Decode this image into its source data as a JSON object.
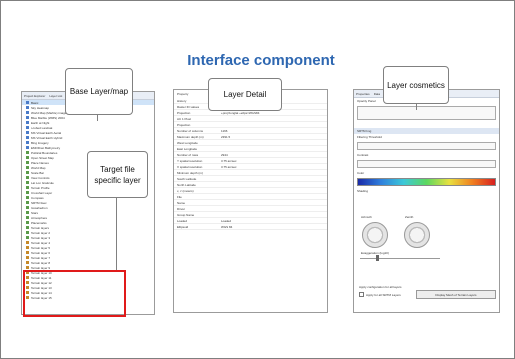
{
  "page": {
    "title": "Interface component"
  },
  "callouts": {
    "base_layer": "Base Layer/map",
    "target_file": "Target file specific layer",
    "layer_detail": "Layer Detail",
    "layer_cosmetics": "Layer cosmetics"
  },
  "colors": {
    "title": "#2e67b1",
    "highlight_box": "#e01a1a"
  },
  "left_panel": {
    "tabs": [
      "Project Explorer",
      "Layer List"
    ],
    "rows": [
      {
        "label": "Basic",
        "icon": "map-icon",
        "selected": true
      },
      {
        "label": "Sky Heatmap",
        "icon": "map-icon"
      },
      {
        "label": "World Map (Marble) image",
        "icon": "map-icon"
      },
      {
        "label": "Blue Marble (WMS) 2004",
        "icon": "map-icon"
      },
      {
        "label": "Earth at Night",
        "icon": "map-icon"
      },
      {
        "label": "i-cubed Landsat",
        "icon": "map-icon"
      },
      {
        "label": "MS Virtual Earth Aerial",
        "icon": "map-icon"
      },
      {
        "label": "MS Virtual Earth Hybrid",
        "icon": "map-icon"
      },
      {
        "label": "Bing Imagery",
        "icon": "map-icon"
      },
      {
        "label": "EMODnet Bathymetry",
        "icon": "map-icon"
      },
      {
        "label": "Political Boundaries",
        "icon": "layer-icon"
      },
      {
        "label": "Open Street Map",
        "icon": "layer-icon"
      },
      {
        "label": "Place Names",
        "icon": "layer-icon"
      },
      {
        "label": "World Map",
        "icon": "layer-icon"
      },
      {
        "label": "Scale Bar",
        "icon": "layer-icon"
      },
      {
        "label": "View Controls",
        "icon": "layer-icon"
      },
      {
        "label": "Lat Lon Graticule",
        "icon": "layer-icon"
      },
      {
        "label": "Terrain Profile",
        "icon": "layer-icon"
      },
      {
        "label": "Crosshair Layer",
        "icon": "layer-icon"
      },
      {
        "label": "Compass",
        "icon": "layer-icon"
      },
      {
        "label": "SRTM 3sec",
        "icon": "layer-icon"
      },
      {
        "label": "Icosahedron",
        "icon": "layer-icon"
      },
      {
        "label": "Stars",
        "icon": "layer-icon"
      },
      {
        "label": "Atmosphere",
        "icon": "layer-icon"
      },
      {
        "label": "Placemarks",
        "icon": "layer-icon"
      },
      {
        "label": "Terrain layers",
        "icon": "layer-icon"
      },
      {
        "label": "Terrain layer 2",
        "icon": "layer-icon"
      },
      {
        "label": "Terrain layer 3",
        "icon": "layer-icon"
      },
      {
        "label": "Terrain layer 4",
        "icon": "tif-icon"
      },
      {
        "label": "Terrain layer 5",
        "icon": "tif-icon"
      },
      {
        "label": "Terrain layer 6",
        "icon": "tif-icon"
      },
      {
        "label": "Terrain layer 7",
        "icon": "tif-icon"
      },
      {
        "label": "Terrain layer 8",
        "icon": "tif-icon"
      },
      {
        "label": "Terrain layer 9",
        "icon": "tif-icon"
      },
      {
        "label": "Terrain layer 10",
        "icon": "tif-icon"
      },
      {
        "label": "Terrain layer 11",
        "icon": "tif-icon"
      },
      {
        "label": "Terrain layer 12",
        "icon": "tif-icon"
      },
      {
        "label": "Terrain layer 13",
        "icon": "tif-icon"
      },
      {
        "label": "Terrain layer 14",
        "icon": "tif-icon"
      },
      {
        "label": "Terrain layer 15",
        "icon": "tif-icon"
      }
    ]
  },
  "middle_panel": {
    "header": "Property",
    "rows": [
      {
        "k": "History",
        "v": ""
      },
      {
        "k": "Raster ID values",
        "v": ""
      },
      {
        "k": "Projection",
        "v": "+proj=longlat +ellps=WGS84"
      },
      {
        "k": "AC 1 Pixel",
        "v": ""
      },
      {
        "k": "Projection",
        "v": ""
      },
      {
        "k": "Number of columns",
        "v": "1166"
      },
      {
        "k": "Maximum depth (m)",
        "v": "2391.5"
      },
      {
        "k": "West Longitude",
        "v": ""
      },
      {
        "k": "East Longitude",
        "v": ""
      },
      {
        "k": "Number of rows",
        "v": "2944"
      },
      {
        "k": "Y spatial resolution",
        "v": "3.75 arcsec"
      },
      {
        "k": "X spatial resolution",
        "v": "3.75 arcsec"
      },
      {
        "k": "Minimum depth (m)",
        "v": ""
      },
      {
        "k": "South Latitude",
        "v": ""
      },
      {
        "k": "North Latitude",
        "v": ""
      },
      {
        "k": "x, z (meters)",
        "v": ""
      },
      {
        "k": "File",
        "v": ""
      },
      {
        "k": "Name",
        "v": ""
      },
      {
        "k": "Driver",
        "v": ""
      },
      {
        "k": "Group Name",
        "v": ""
      },
      {
        "k": "Loaded",
        "v": "Loaded"
      },
      {
        "k": "Ellipsoid",
        "v": "WGS 84"
      }
    ]
  },
  "right_panel": {
    "tabs": [
      "Properties",
      "Data"
    ],
    "opacity_label": "Opacity Panel",
    "section": "SRTM Img",
    "filter_label": "Filtering Threshold",
    "contrast_label": "Contrast",
    "color_label": "Color",
    "shading_label": "Shading",
    "azimuth_label": "Azimuth",
    "zenith_label": "Zenith",
    "exaggeration_label": "Exaggeration (log10)",
    "apply_label": "Apply configuration for all layers",
    "apply_check": "Apply for all SRTM Layers",
    "display_button": "Display Mesh of Terrain Layers"
  }
}
